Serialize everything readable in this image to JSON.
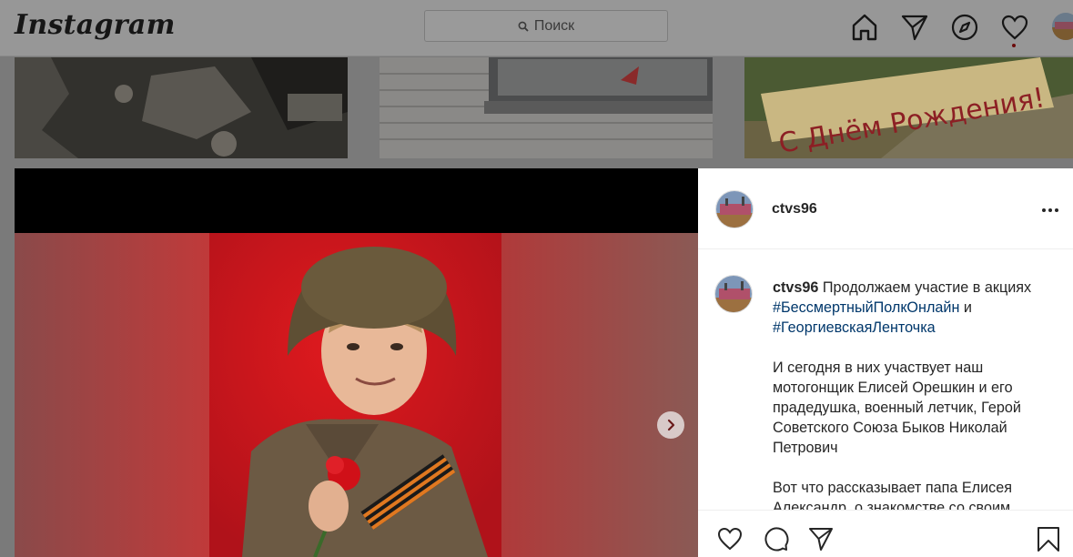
{
  "header": {
    "logo": "Instagram",
    "search_placeholder": "Поиск"
  },
  "nav_icons": [
    "home-icon",
    "direct-icon",
    "explore-icon",
    "activity-heart-icon",
    "profile-avatar"
  ],
  "thumbnails": [
    {
      "name": "grid-post-1"
    },
    {
      "name": "grid-post-2"
    },
    {
      "name": "grid-post-3",
      "overlay_text": "С Днём Рождения!"
    }
  ],
  "post": {
    "username": "ctvs96",
    "caption": {
      "username": "ctvs96",
      "line1": "Продолжаем участие в акциях",
      "tag1": "#БессмертныйПолкОнлайн",
      "and": "и",
      "tag2": "#ГеоргиевскаяЛенточка",
      "para2": "И сегодня в них участвует наш мотогонщик Елисей Орешкин и его прадедушка, военный летчик, Герой Советского Союза Быков Николай Петрович",
      "para3": "Вот что рассказывает папа Елисея Александр, о знакомстве со своим"
    },
    "actions": [
      "like-icon",
      "comment-icon",
      "share-icon",
      "save-icon"
    ]
  },
  "colors": {
    "accent_link": "#00376b",
    "text": "#262626",
    "overlay": "#7a7a7a",
    "photo_background": "#c4131b"
  }
}
